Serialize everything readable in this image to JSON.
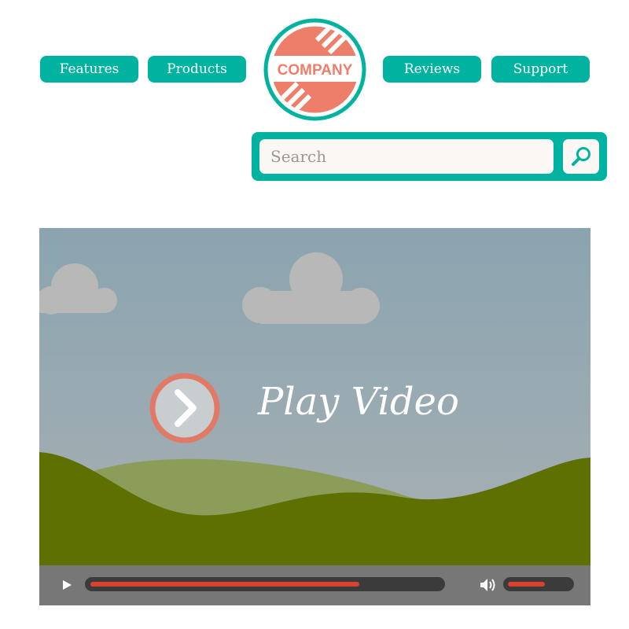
{
  "colors": {
    "teal": "#00b3a0",
    "coral": "#ec7e6a",
    "sky_top": "#8aa4b0",
    "sky_bottom": "#a8b0b3",
    "hill_dark": "#5e7000",
    "hill_light": "#8c9d5a",
    "cloud": "#b8b8b8",
    "control_bar": "#777777",
    "progress": "#d9432e"
  },
  "nav": {
    "features": "Features",
    "products": "Products",
    "reviews": "Reviews",
    "support": "Support"
  },
  "logo": {
    "text": "COMPANY"
  },
  "search": {
    "placeholder": "Search",
    "icon": "magnifier-icon"
  },
  "video": {
    "title": "Play Video",
    "play_icon": "chevron-right-icon",
    "progress": 0.77,
    "volume": 0.6,
    "controls": {
      "play_icon": "play-triangle-icon",
      "volume_icon": "speaker-icon"
    }
  }
}
